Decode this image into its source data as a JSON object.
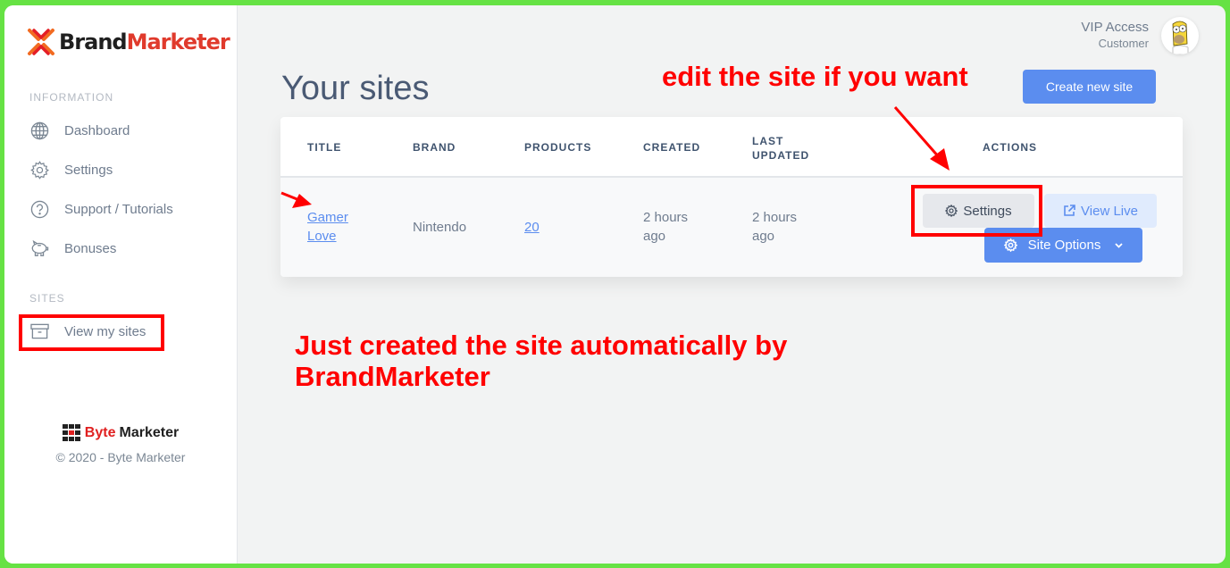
{
  "brand": {
    "name_part1": "Brand",
    "name_part2": "Marketer",
    "accent": "#e03a2c"
  },
  "sidebar": {
    "sections": [
      {
        "label": "INFORMATION",
        "items": [
          {
            "label": "Dashboard",
            "icon": "globe-icon"
          },
          {
            "label": "Settings",
            "icon": "gear-icon"
          },
          {
            "label": "Support / Tutorials",
            "icon": "question-circle-icon"
          },
          {
            "label": "Bonuses",
            "icon": "piggy-bank-icon"
          }
        ]
      },
      {
        "label": "SITES",
        "items": [
          {
            "label": "View my sites",
            "icon": "archive-box-icon"
          }
        ]
      }
    ],
    "footer": {
      "logo_part1": "Byte",
      "logo_part2": "Marketer",
      "copyright": "© 2020 - Byte Marketer"
    }
  },
  "user": {
    "name": "VIP Access",
    "role": "Customer",
    "avatar": "homer-avatar"
  },
  "main": {
    "title": "Your sites",
    "create_button": "Create new site",
    "table": {
      "columns": [
        "TITLE",
        "BRAND",
        "PRODUCTS",
        "CREATED",
        "LAST",
        "UPDATED",
        "ACTIONS"
      ],
      "rows": [
        {
          "title_line1": "Gamer",
          "title_line2": "Love",
          "brand": "Nintendo",
          "products": "20",
          "created_line1": "2 hours",
          "created_line2": "ago",
          "updated_line1": "2 hours",
          "updated_line2": "ago",
          "actions": {
            "settings": "Settings",
            "view_live": "View Live",
            "site_options": "Site Options"
          }
        }
      ]
    }
  },
  "annotations": {
    "top": "edit the site if you want",
    "bottom_line1": "Just created the site automatically by",
    "bottom_line2": "BrandMarketer",
    "color": "#ff0000"
  },
  "colors": {
    "primary": "#5b8def",
    "frame": "#66e244",
    "background": "#f2f3f3"
  }
}
